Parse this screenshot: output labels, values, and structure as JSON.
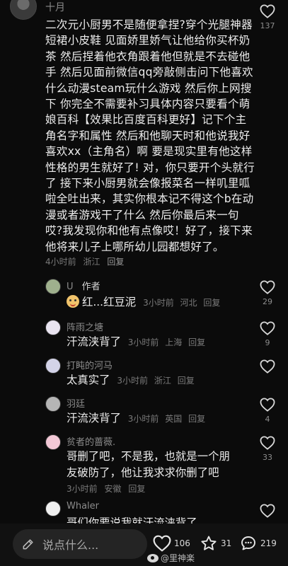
{
  "main_comment": {
    "username": "十月",
    "text": "二次元小厨男不是随便拿捏?穿个光腿神器短裙小皮鞋 见面娇里娇气让他给你买杯奶茶 然后捏着他衣角跟着他但就是不去碰他手 然后见面前微信qq旁敲侧击问下他喜欢什么动漫steam玩什么游戏 然后你上网搜下 你完全不需要补习具体内容只要看个萌娘百科【效果比百度百科更好】记下个主角名字和属性 然后和他聊天时和他说我好喜欢xx（主角名）啊 要是现实里有他这样性格的男生就好了! 对，你只要开个头就行了 接下来小厨男就会像报菜名一样叽里呱啦全吐出来，其实你根本记不得这个b在动漫或者游戏干了什么 然后你最后来一句 哎?我发现你和他有点像哎！好了，接下来他将来儿子上哪所幼儿园都想好了。",
    "time": "4小时前",
    "location": "浙江",
    "reply_label": "回复",
    "likes": "137"
  },
  "replies": [
    {
      "username": "U",
      "tag": "作者",
      "text": "红...红豆泥",
      "time": "3小时前",
      "location": "河北",
      "reply_label": "回复",
      "likes": "29"
    },
    {
      "username": "阵雨之塘",
      "text": "汗流浃背了",
      "time": "3小时前",
      "location": "上海",
      "reply_label": "回复",
      "likes": "9"
    },
    {
      "username": "打盹的河马",
      "text": "太真实了",
      "time": "3小时前",
      "location": "浙江",
      "reply_label": "回复",
      "likes": ""
    },
    {
      "username": "羽廷",
      "text": "汗流浃背了",
      "time": "3小时前",
      "location": "英国",
      "reply_label": "回复",
      "likes": "4"
    },
    {
      "username": "贫者的蔷薇.",
      "text": "哥删了吧，不是我，也就是一个朋友破防了，他让我求求你删了吧",
      "time": "3小时前",
      "location": "安徽",
      "reply_label": "回复",
      "likes": "33"
    },
    {
      "username": "Whaler",
      "text": "哥们你要说我就汗流浃背了",
      "likes": ""
    }
  ],
  "bottom_bar": {
    "input_placeholder": "说点什么...",
    "like_count": "106",
    "star_count": "31",
    "comment_count": "219",
    "watermark": "@里神楽"
  },
  "icons": {
    "heart": "heart-outline-icon",
    "pen": "pen-icon",
    "star": "star-outline-icon",
    "comment": "comment-bubble-icon"
  },
  "colors": {
    "background": "#0b0b0b",
    "text": "#ececec",
    "muted": "#8b8b8b"
  }
}
